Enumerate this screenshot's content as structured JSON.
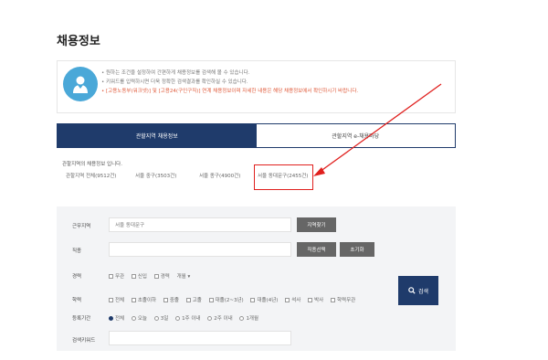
{
  "page": {
    "title": "채용정보"
  },
  "notice": {
    "lines": [
      "• 원하는 조건을 설정하여 간편하게 채용정보를 검색해 볼 수 있습니다.",
      "• 키워드를 입력하시면 더욱 정확한 검색결과를 확인하실 수 있습니다.",
      "• [고용노동부(워크넷)] 및 [고용24(구인구직)] 연계 채용정보이며 자세한 내용은 해당 채용정보에서 확인하시기 바랍니다."
    ]
  },
  "tabs": [
    {
      "label": "관할지역 채용정보",
      "active": true
    },
    {
      "label": "관할지역 e-채용마당",
      "active": false
    }
  ],
  "results": {
    "heading": "관할지역의 채용정보 입니다.",
    "filters": [
      "관할지역 전체(9512건)",
      "서울 중구(3503건)",
      "서울 종구(4900건)",
      "서울 동대문구(2455건)"
    ],
    "highlight_index": 3
  },
  "search": {
    "location_label": "근무지역",
    "location_value": "서울 동대문구",
    "location_button": "지역찾기",
    "job_label": "직종",
    "job_button": "직종선택",
    "job_reset_button": "초기화",
    "career_label": "경력",
    "career_options": [
      "무관",
      "신입",
      "경력"
    ],
    "career_suffix": "개월",
    "education_label": "학력",
    "education_options": [
      "전체",
      "초졸이하",
      "중졸",
      "고졸",
      "대졸(2~3년)",
      "대졸(4년)",
      "석사",
      "박사",
      "학력무관"
    ],
    "period_label": "등록기간",
    "period_options": [
      "전체",
      "오늘",
      "3일",
      "1주 이내",
      "2주 이내",
      "1개월"
    ],
    "period_selected": 0,
    "keyword_label": "검색키워드",
    "keyword_placeholder": "",
    "submit_label": "검색"
  },
  "colors": {
    "accent": "#1f3b6b",
    "highlight": "#e0201e",
    "notice_icon": "#4aa8d8"
  },
  "icons": {
    "notice": "person-icon",
    "search": "search-icon"
  }
}
